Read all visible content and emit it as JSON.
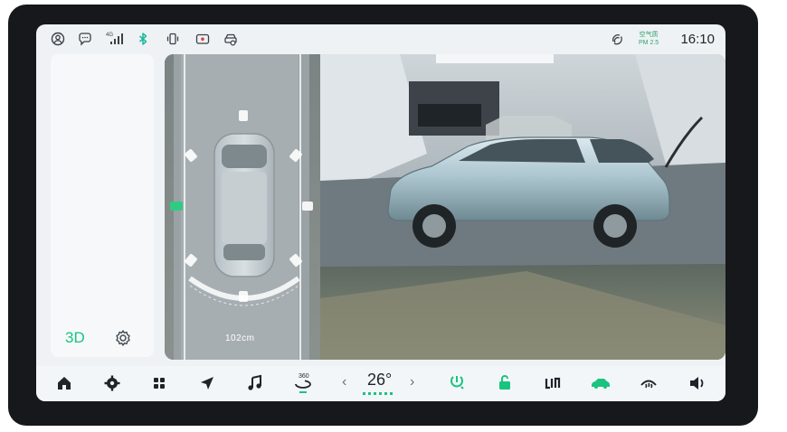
{
  "status_bar": {
    "icons": [
      "profile-icon",
      "message-icon",
      "cellular-signal-icon",
      "bluetooth-icon",
      "vibrate-icon",
      "camera-record-icon",
      "dashcam-icon",
      "wireless-charging-icon"
    ],
    "signal_label": "4G",
    "air_quality_label": "空气质",
    "air_quality_value": "PM 2.5",
    "time": "16:10"
  },
  "side_panel": {
    "mode_label": "3D",
    "settings_icon": "gear-icon"
  },
  "camera_view": {
    "distance_label": "102cm",
    "views": [
      "top-down-view",
      "3d-perspective-view"
    ]
  },
  "dock": {
    "items": [
      "home-icon",
      "settings-icon",
      "apps-grid-icon",
      "navigation-icon",
      "music-icon",
      "360-camera-icon",
      "temp-decrease",
      "temperature",
      "temp-increase",
      "seat-heat-icon",
      "lock-icon",
      "seat-icon",
      "car-icon",
      "defrost-icon",
      "volume-icon"
    ],
    "camera_360_label": "360",
    "temperature": "26°",
    "temp_left": "‹",
    "temp_right": "›"
  },
  "colors": {
    "accent": "#19c47e",
    "bluetooth": "#1fb89a",
    "screen_bg": "#eef2f5",
    "bezel": "#16181b"
  }
}
